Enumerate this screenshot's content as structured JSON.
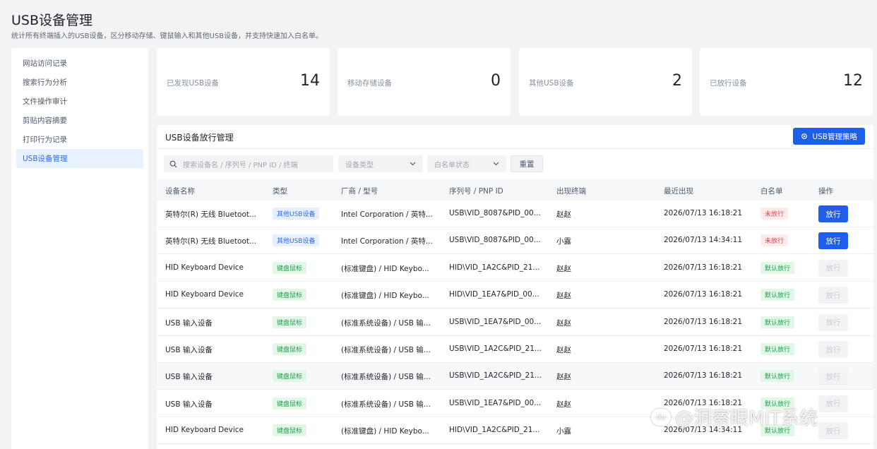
{
  "page": {
    "title": "USB设备管理",
    "subtitle": "统计所有终端插入的USB设备，区分移动存储、键鼠输入和其他USB设备，并支持快速加入白名单。"
  },
  "sidebar": {
    "items": [
      {
        "label": "网站访问记录",
        "active": false
      },
      {
        "label": "搜索行为分析",
        "active": false
      },
      {
        "label": "文件操作审计",
        "active": false
      },
      {
        "label": "剪贴内容摘要",
        "active": false
      },
      {
        "label": "打印行为记录",
        "active": false
      },
      {
        "label": "USB设备管理",
        "active": true
      }
    ]
  },
  "stats": [
    {
      "label": "已发现USB设备",
      "value": "14"
    },
    {
      "label": "移动存储设备",
      "value": "0"
    },
    {
      "label": "其他USB设备",
      "value": "2"
    },
    {
      "label": "已放行设备",
      "value": "12"
    }
  ],
  "panel": {
    "title": "USB设备放行管理",
    "policy_button": "USB管理策略",
    "policy_icon": "gear-icon"
  },
  "filters": {
    "search_placeholder": "搜索设备名 / 序列号 / PNP ID / 终端",
    "type_placeholder": "设备类型",
    "status_placeholder": "白名单状态",
    "reset_label": "重置"
  },
  "table": {
    "columns": [
      "设备名称",
      "类型",
      "厂商 / 型号",
      "序列号 / PNP ID",
      "出现终端",
      "最近出现",
      "白名单",
      "操作"
    ],
    "rows": [
      {
        "name": "英特尔(R) 无线 Bluetoot...",
        "type": "其他USB设备",
        "vendor": "Intel Corporation / 英特...",
        "pnp": "USB\\VID_8087&PID_00...",
        "terminal": "赵赵",
        "last_seen": "2026/07/13 16:18:21",
        "whitelist": "未放行",
        "action": "放行"
      },
      {
        "name": "英特尔(R) 无线 Bluetoot...",
        "type": "其他USB设备",
        "vendor": "Intel Corporation / 英特...",
        "pnp": "USB\\VID_8087&PID_00...",
        "terminal": "小露",
        "last_seen": "2026/07/13 14:34:11",
        "whitelist": "未放行",
        "action": "放行"
      },
      {
        "name": "HID Keyboard Device",
        "type": "键盘鼠标",
        "vendor": "(标准键盘) / HID Keybo...",
        "pnp": "HID\\VID_1A2C&PID_21...",
        "terminal": "赵赵",
        "last_seen": "2026/07/13 16:18:21",
        "whitelist": "默认放行",
        "action": "放行"
      },
      {
        "name": "HID Keyboard Device",
        "type": "键盘鼠标",
        "vendor": "(标准键盘) / HID Keybo...",
        "pnp": "HID\\VID_1EA7&PID_00...",
        "terminal": "赵赵",
        "last_seen": "2026/07/13 16:18:21",
        "whitelist": "默认放行",
        "action": "放行"
      },
      {
        "name": "USB 输入设备",
        "type": "键盘鼠标",
        "vendor": "(标准系统设备) / USB 输...",
        "pnp": "USB\\VID_1EA7&PID_00...",
        "terminal": "赵赵",
        "last_seen": "2026/07/13 16:18:21",
        "whitelist": "默认放行",
        "action": "放行"
      },
      {
        "name": "USB 输入设备",
        "type": "键盘鼠标",
        "vendor": "(标准系统设备) / USB 输...",
        "pnp": "USB\\VID_1A2C&PID_21...",
        "terminal": "赵赵",
        "last_seen": "2026/07/13 16:18:21",
        "whitelist": "默认放行",
        "action": "放行"
      },
      {
        "name": "USB 输入设备",
        "type": "键盘鼠标",
        "vendor": "(标准系统设备) / USB 输...",
        "pnp": "USB\\VID_1A2C&PID_21...",
        "terminal": "赵赵",
        "last_seen": "2026/07/13 16:18:21",
        "whitelist": "默认放行",
        "action": "放行"
      },
      {
        "name": "USB 输入设备",
        "type": "键盘鼠标",
        "vendor": "(标准系统设备) / USB 输...",
        "pnp": "USB\\VID_1EA7&PID_00...",
        "terminal": "赵赵",
        "last_seen": "2026/07/13 16:18:21",
        "whitelist": "默认放行",
        "action": "放行"
      },
      {
        "name": "HID Keyboard Device",
        "type": "键盘鼠标",
        "vendor": "(标准键盘) / HID Keybo...",
        "pnp": "HID\\VID_1A2C&PID_21...",
        "terminal": "小露",
        "last_seen": "2026/07/13 14:34:11",
        "whitelist": "默认放行",
        "action": "放行"
      }
    ]
  },
  "watermark": {
    "logo_text": "du",
    "text": "@洞察眼MIT系统"
  },
  "colors": {
    "accent": "#1f5ee8",
    "active_bg": "#e8f1ff",
    "not_allowed": "#e54545",
    "default_allowed": "#1f9e4d"
  }
}
